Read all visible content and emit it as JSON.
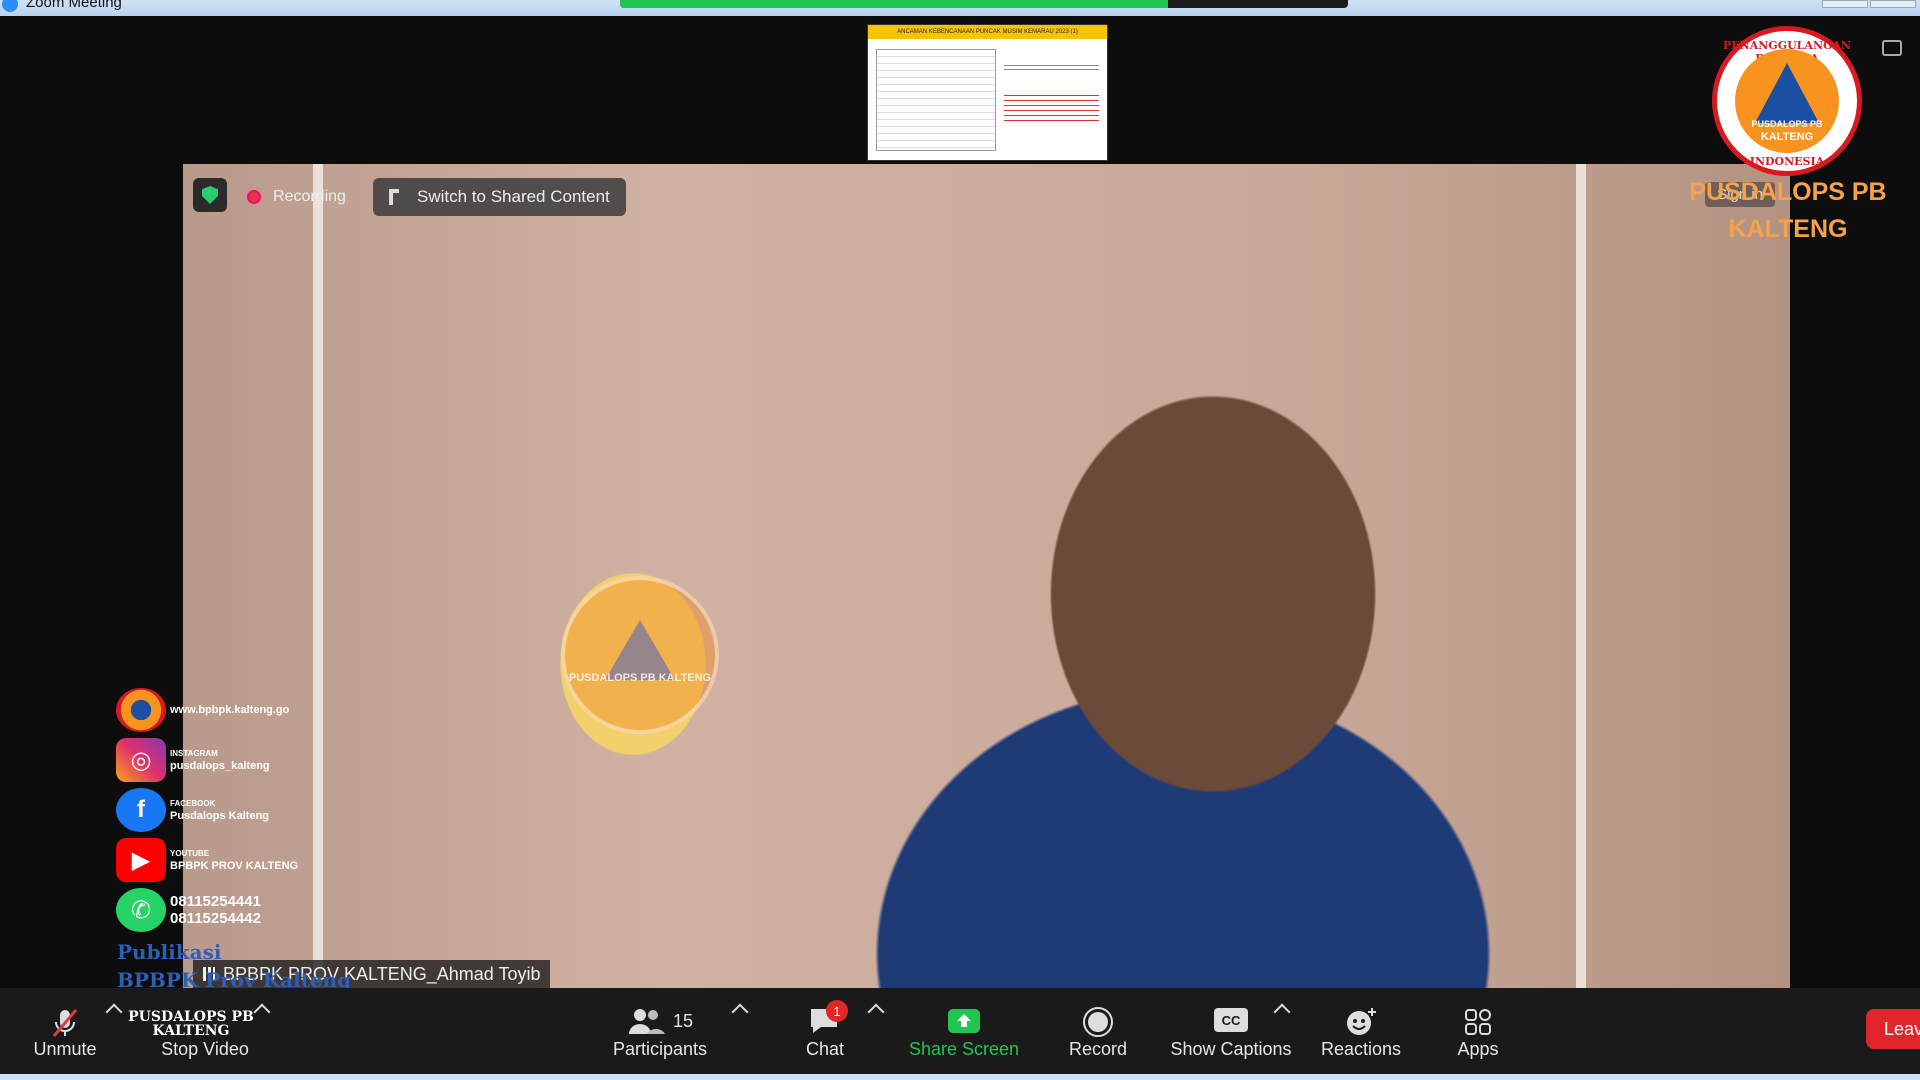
{
  "window": {
    "title": "Zoom Meeting"
  },
  "shared_thumbnail": {
    "header": "ANCAMAN KEBENCANAAN PUNCAK MUSIM KEMARAU 2023 (1)"
  },
  "video": {
    "recording_label": "Recording",
    "switch_label": "Switch to Shared Content",
    "signin_label": "Sign in",
    "participant_name": "BPBPK PROV KALTENG_Ahmad Toyib",
    "watermark": {
      "arc": "PENANGGULANGAN BENCANA",
      "center": "PUSDALOPS PB KALTENG",
      "bottom": "INDONESIA"
    }
  },
  "logo": {
    "arc_top": "PENANGGULANGAN BENCANA",
    "line1": "PUSDALOPS PB",
    "line2": "KALTENG",
    "arc_bottom": "INDONESIA",
    "caption_line1": "PUSDALOPS PB",
    "caption_line2": "KALTENG"
  },
  "social": {
    "website": "www.bpbpk.kalteng.go",
    "instagram_cap": "INSTAGRAM",
    "instagram": "pusdalops_kalteng",
    "facebook_cap": "FACEBOOK",
    "facebook": "Pusdalops Kalteng",
    "youtube_cap": "YOUTUBE",
    "youtube": "BPBPK PROV KALTENG",
    "phone1": "08115254441",
    "phone2": "08115254442",
    "pub_line1": "Publikasi",
    "pub_line2": "BPBPK Prov Kalteng",
    "pub_logo_line1": "PUSDALOPS PB",
    "pub_logo_line2": "KALTENG"
  },
  "toolbar": {
    "unmute": "Unmute",
    "stop_video": "Stop Video",
    "participants": "Participants",
    "participants_count": "15",
    "chat": "Chat",
    "chat_badge": "1",
    "share_screen": "Share Screen",
    "record": "Record",
    "show_captions": "Show Captions",
    "reactions": "Reactions",
    "apps": "Apps",
    "leave": "Leave"
  },
  "colors": {
    "accent_green": "#23c552",
    "leave_red": "#e0262b",
    "logo_caption": "#f6a14b"
  }
}
